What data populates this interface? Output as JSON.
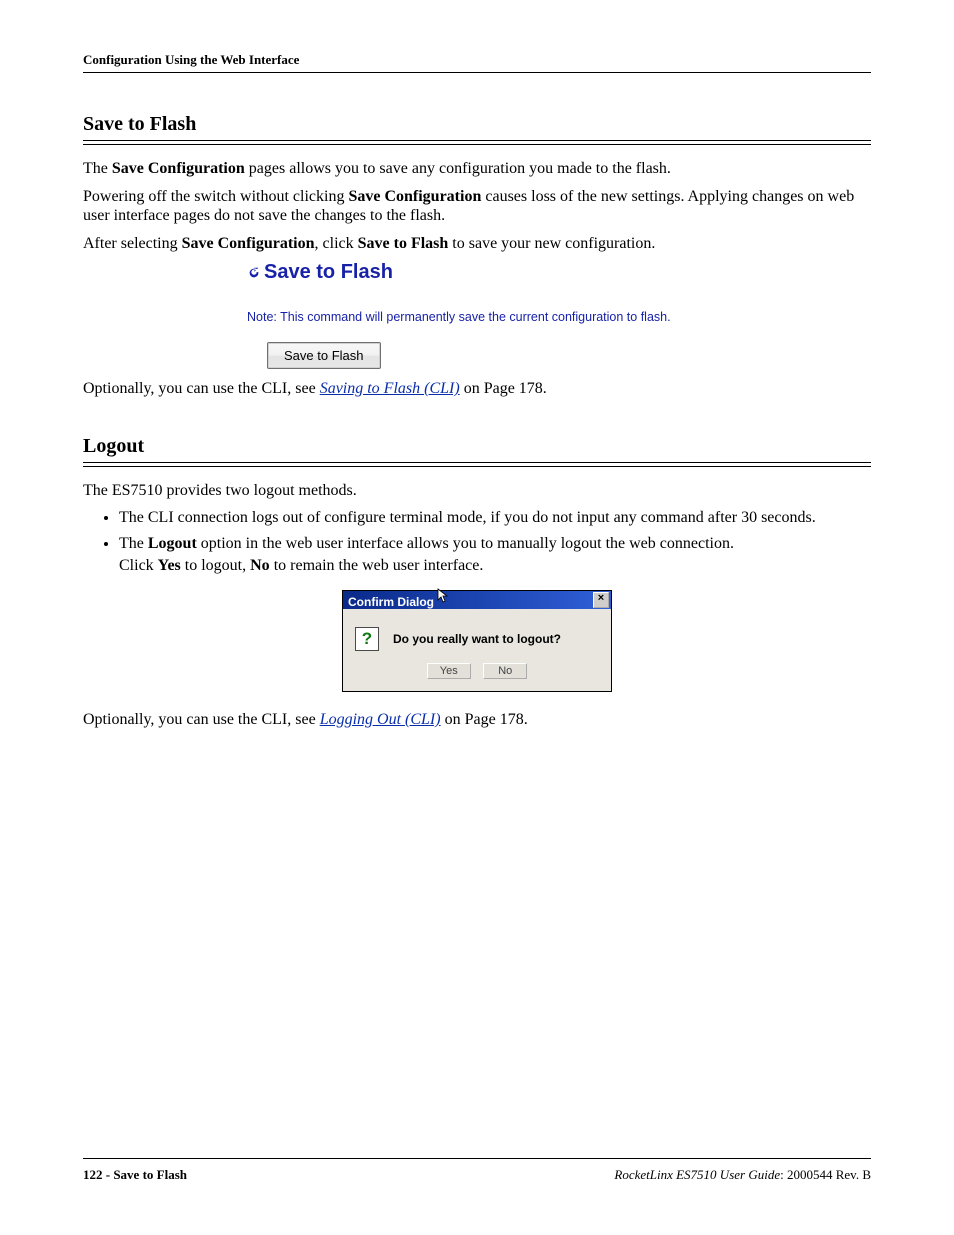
{
  "header": {
    "title": "Configuration Using the Web Interface"
  },
  "section1": {
    "heading": "Save to Flash",
    "para1_prefix": "The ",
    "para1_bold": "Save Configuration",
    "para1_suffix": " pages allows you to save any configuration you made to the flash.",
    "para2_prefix": "Powering off the switch without clicking ",
    "para2_bold": "Save Configuration",
    "para2_suffix": " causes loss of the new settings. Applying changes on web user interface pages do not save the changes to the flash.",
    "para3_prefix": "After selecting ",
    "para3_bold1": "Save Configuration",
    "para3_mid": ", click ",
    "para3_bold2": "Save to Flash",
    "para3_suffix": " to save your new configuration.",
    "panel_title": "Save to Flash",
    "panel_note": "Note: This command will permanently save the current configuration to flash.",
    "panel_button": "Save to Flash",
    "cli_prefix": "Optionally, you can use the CLI, see ",
    "cli_link": "Saving to Flash (CLI)",
    "cli_suffix": " on Page 178."
  },
  "section2": {
    "heading": "Logout",
    "intro": "The ES7510 provides two logout methods.",
    "bullet1": "The CLI connection logs out of configure terminal mode, if you do not input any command after 30 seconds.",
    "bullet2_prefix": "The ",
    "bullet2_bold": "Logout",
    "bullet2_suffix": " option in the web user interface allows you to manually logout the web connection.",
    "bullet2_line2_prefix": "Click ",
    "bullet2_line2_bold1": "Yes",
    "bullet2_line2_mid": " to logout, ",
    "bullet2_line2_bold2": "No",
    "bullet2_line2_suffix": " to remain the web user interface.",
    "dialog_title": "Confirm Dialog",
    "dialog_message": "Do you really want to logout?",
    "dialog_yes": "Yes",
    "dialog_no": "No",
    "cli_prefix": "Optionally, you can use the CLI, see ",
    "cli_link": "Logging Out (CLI)",
    "cli_suffix": " on Page 178."
  },
  "footer": {
    "left": "122 - Save to Flash",
    "right_product": "RocketLinx ES7510  User Guide",
    "right_rev": ": 2000544 Rev. B"
  },
  "icons": {
    "close": "×",
    "question": "?"
  }
}
